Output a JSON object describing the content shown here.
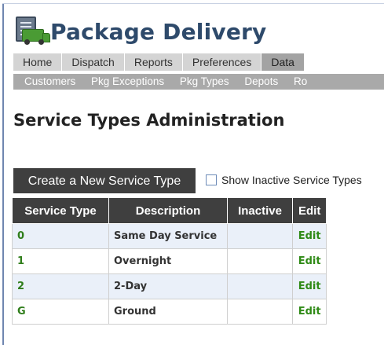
{
  "app": {
    "title": "Package Delivery"
  },
  "tabs": [
    {
      "label": "Home"
    },
    {
      "label": "Dispatch"
    },
    {
      "label": "Reports"
    },
    {
      "label": "Preferences"
    },
    {
      "label": "Data",
      "active": true
    }
  ],
  "subnav": [
    {
      "label": "Customers"
    },
    {
      "label": "Pkg Exceptions"
    },
    {
      "label": "Pkg Types"
    },
    {
      "label": "Depots"
    },
    {
      "label": "Ro"
    }
  ],
  "page": {
    "title": "Service Types Administration"
  },
  "actions": {
    "create_label": "Create a New Service Type",
    "show_inactive_label": "Show Inactive Service Types",
    "show_inactive_checked": false
  },
  "table": {
    "headers": [
      "Service Type",
      "Description",
      "Inactive",
      "Edit"
    ],
    "rows": [
      {
        "code": "0",
        "description": "Same Day Service",
        "inactive": "",
        "edit": "Edit"
      },
      {
        "code": "1",
        "description": "Overnight",
        "inactive": "",
        "edit": "Edit"
      },
      {
        "code": "2",
        "description": "2-Day",
        "inactive": "",
        "edit": "Edit"
      },
      {
        "code": "G",
        "description": "Ground",
        "inactive": "",
        "edit": "Edit"
      }
    ]
  },
  "icons": {
    "logo": "package-truck-icon"
  },
  "colors": {
    "title": "#2e4a6b",
    "dark_header": "#3f3f3f",
    "link_green": "#2f8a16",
    "row_alt": "#eaf0f9"
  }
}
